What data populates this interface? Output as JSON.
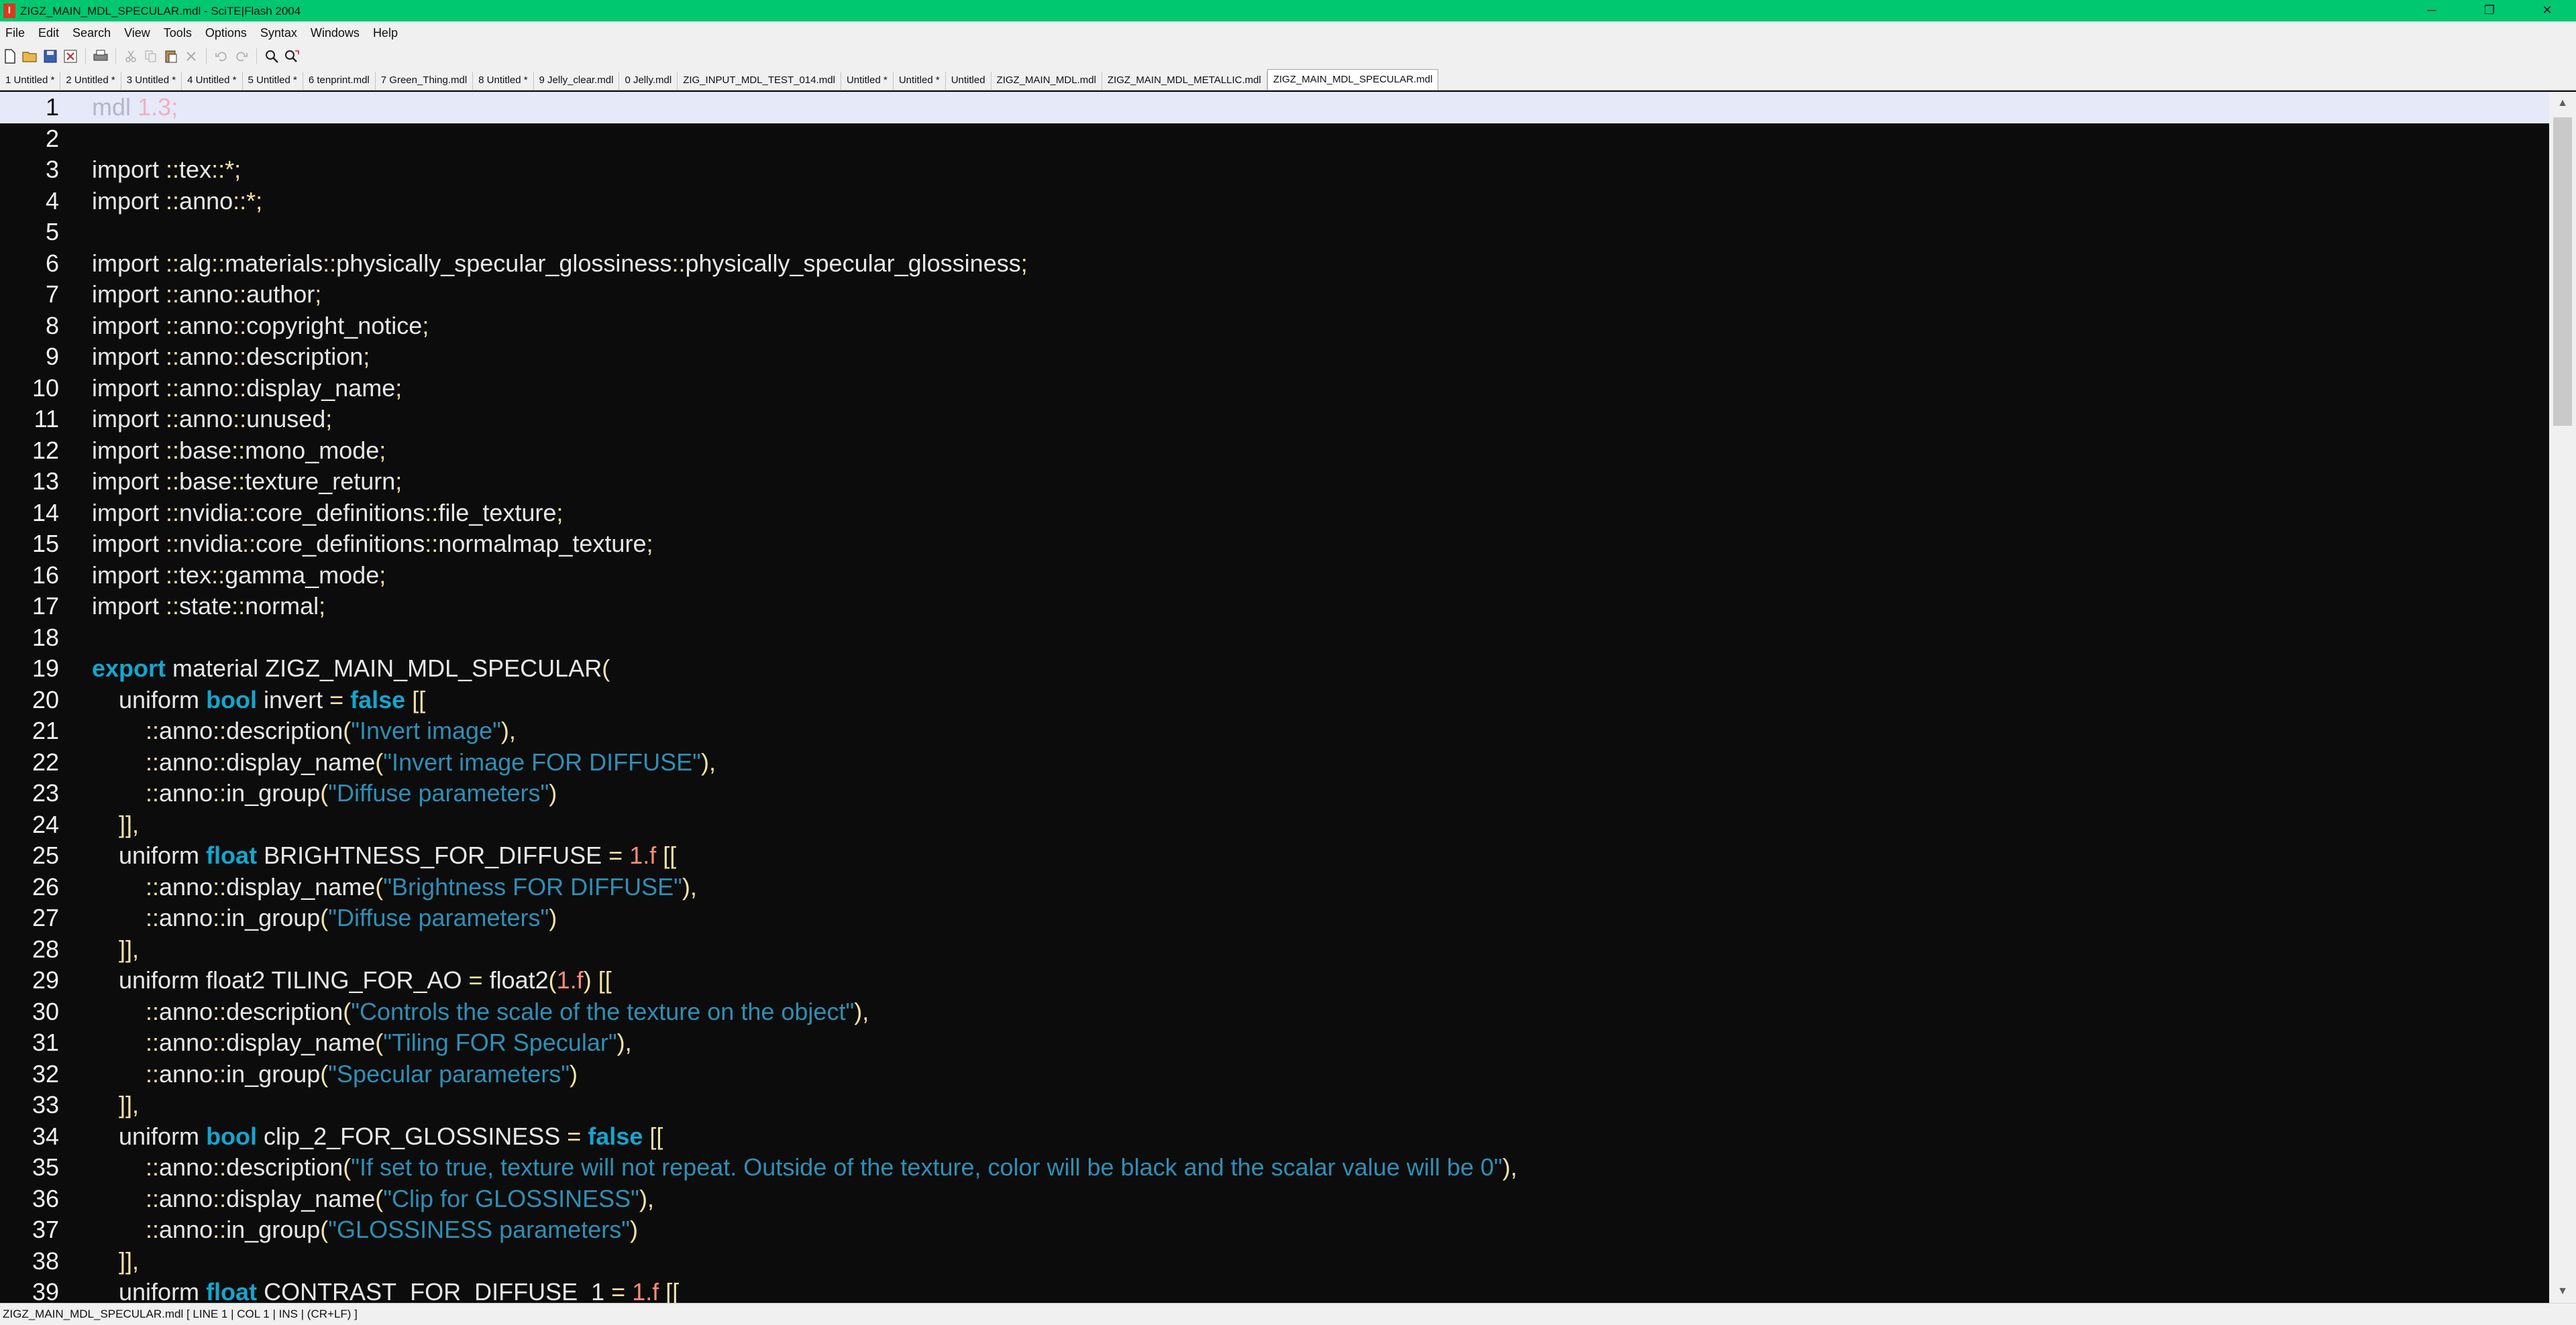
{
  "window": {
    "title": "ZIGZ_MAIN_MDL_SPECULAR.mdl - SciTE|Flash 2004",
    "app_icon": "app-icon"
  },
  "menu": [
    "File",
    "Edit",
    "Search",
    "View",
    "Tools",
    "Options",
    "Syntax",
    "Windows",
    "Help"
  ],
  "tabs": [
    "1 Untitled *",
    "2 Untitled *",
    "3 Untitled *",
    "4 Untitled *",
    "5 Untitled *",
    "6 tenprint.mdl",
    "7 Green_Thing.mdl",
    "8 Untitled *",
    "9 Jelly_clear.mdl",
    "0 Jelly.mdl",
    "ZIG_INPUT_MDL_TEST_014.mdl",
    "Untitled *",
    "Untitled *",
    "Untitled",
    "ZIGZ_MAIN_MDL.mdl",
    "ZIGZ_MAIN_MDL_METALLIC.mdl",
    "ZIGZ_MAIN_MDL_SPECULAR.mdl"
  ],
  "active_tab_index": 16,
  "editor": {
    "current_line": 1,
    "lines": [
      "mdl 1.3;",
      "",
      "import ::tex::*;",
      "import ::anno::*;",
      "",
      "import ::alg::materials::physically_specular_glossiness::physically_specular_glossiness;",
      "import ::anno::author;",
      "import ::anno::copyright_notice;",
      "import ::anno::description;",
      "import ::anno::display_name;",
      "import ::anno::unused;",
      "import ::base::mono_mode;",
      "import ::base::texture_return;",
      "import ::nvidia::core_definitions::file_texture;",
      "import ::nvidia::core_definitions::normalmap_texture;",
      "import ::tex::gamma_mode;",
      "import ::state::normal;",
      "",
      "export material ZIGZ_MAIN_MDL_SPECULAR(",
      "    uniform bool invert = false [[",
      "        ::anno::description(\"Invert image\"),",
      "        ::anno::display_name(\"Invert image FOR DIFFUSE\"),",
      "        ::anno::in_group(\"Diffuse parameters\")",
      "    ]],",
      "    uniform float BRIGHTNESS_FOR_DIFFUSE = 1.f [[",
      "        ::anno::display_name(\"Brightness FOR DIFFUSE\"),",
      "        ::anno::in_group(\"Diffuse parameters\")",
      "    ]],",
      "    uniform float2 TILING_FOR_AO = float2(1.f) [[",
      "        ::anno::description(\"Controls the scale of the texture on the object\"),",
      "        ::anno::display_name(\"Tiling FOR Specular\"),",
      "        ::anno::in_group(\"Specular parameters\")",
      "    ]],",
      "    uniform bool clip_2_FOR_GLOSSINESS = false [[",
      "        ::anno::description(\"If set to true, texture will not repeat. Outside of the texture, color will be black and the scalar value will be 0\"),",
      "        ::anno::display_name(\"Clip for GLOSSINESS\"),",
      "        ::anno::in_group(\"GLOSSINESS parameters\")",
      "    ]],",
      "    uniform float CONTRAST_FOR_DIFFUSE_1 = 1.f [["
    ]
  },
  "status": "ZIGZ_MAIN_MDL_SPECULAR.mdl [ LINE 1 | COL 1 | INS | (CR+LF) ]",
  "colors": {
    "background": "#0c0c0c",
    "keyword": "#13a6cf",
    "string": "#2f8fb6",
    "number": "#ff8c7a",
    "operator": "#f5e3a6",
    "titlebar": "#00c870"
  }
}
